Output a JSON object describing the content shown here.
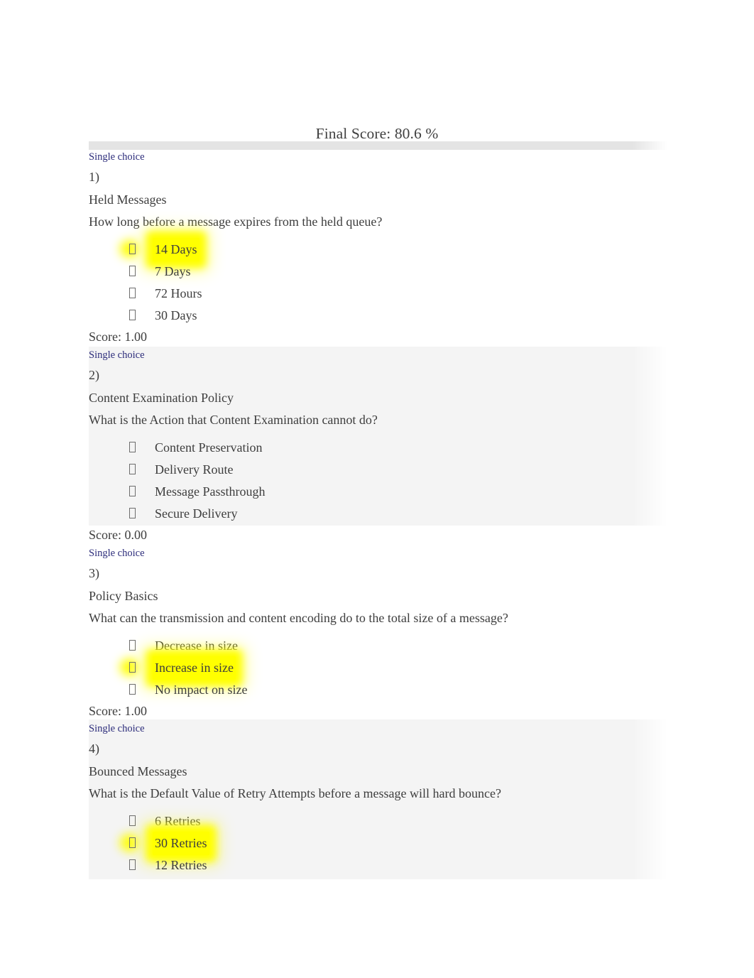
{
  "document": {
    "title": "Final Score: 80.6 %",
    "highlight_color": "#ffff00",
    "type_label_color": "#2b2b7a",
    "band_color": "#f4f4f4"
  },
  "questions": [
    {
      "type_label": "Single choice",
      "number": "1)",
      "topic": "Held Messages",
      "text": "How long before a message expires from the held queue?",
      "options": [
        {
          "label": "14 Days",
          "selected": true
        },
        {
          "label": "7 Days",
          "selected": false
        },
        {
          "label": "72 Hours",
          "selected": false
        },
        {
          "label": "30 Days",
          "selected": false
        }
      ],
      "score": "Score: 1.00"
    },
    {
      "type_label": "Single choice",
      "number": "2)",
      "topic": "Content Examination Policy",
      "text": "What is the Action that Content Examination cannot do?",
      "options": [
        {
          "label": "Content Preservation",
          "selected": false
        },
        {
          "label": "Delivery Route",
          "selected": false
        },
        {
          "label": "Message Passthrough",
          "selected": false
        },
        {
          "label": "Secure Delivery",
          "selected": false
        }
      ],
      "score": "Score: 0.00"
    },
    {
      "type_label": "Single choice",
      "number": "3)",
      "topic": "Policy Basics",
      "text": "What can the transmission and content encoding do to the total size of a message?",
      "options": [
        {
          "label": "Decrease in size",
          "selected": false
        },
        {
          "label": "Increase in size",
          "selected": true
        },
        {
          "label": "No impact on size",
          "selected": false
        }
      ],
      "score": "Score: 1.00"
    },
    {
      "type_label": "Single choice",
      "number": "4)",
      "topic": "Bounced Messages",
      "text": "What is the Default Value of Retry Attempts before a message will hard bounce?",
      "options": [
        {
          "label": "6 Retries",
          "selected": false
        },
        {
          "label": "30 Retries",
          "selected": true
        },
        {
          "label": "12 Retries",
          "selected": false
        }
      ],
      "score": ""
    }
  ]
}
